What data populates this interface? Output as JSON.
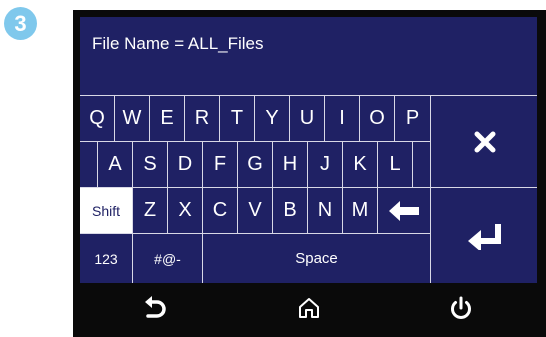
{
  "step_badge": "3",
  "file_name": {
    "label": "File Name",
    "separator": " = ",
    "value": "ALL_Files"
  },
  "keyboard": {
    "row1": [
      "Q",
      "W",
      "E",
      "R",
      "T",
      "Y",
      "U",
      "I",
      "O",
      "P"
    ],
    "row2": [
      "A",
      "S",
      "D",
      "F",
      "G",
      "H",
      "J",
      "K",
      "L"
    ],
    "row3": {
      "shift": "Shift",
      "keys": [
        "Z",
        "X",
        "C",
        "V",
        "B",
        "N",
        "M"
      ]
    },
    "row4": {
      "numbers": "123",
      "symbols": "#@-",
      "space": "Space"
    }
  },
  "icons": {
    "backspace": "left-arrow-icon",
    "clear": "close-icon",
    "enter": "enter-icon",
    "back": "back-arrow-icon",
    "home": "home-icon",
    "power": "power-icon"
  },
  "colors": {
    "screen": "#1f2164",
    "shift_active": "#ffffff",
    "badge": "#7fc8ec",
    "bezel": "#0a0a0a"
  }
}
